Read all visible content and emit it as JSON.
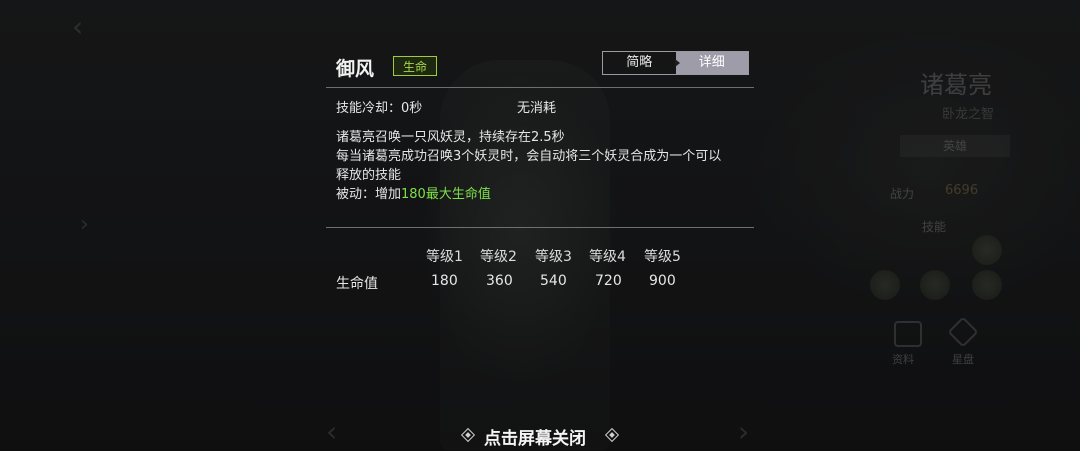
{
  "skill": {
    "name": "御风",
    "badge": "生命",
    "tabs": [
      "简略",
      "详细"
    ],
    "active_tab": "详细",
    "cooldown": "技能冷却：0秒",
    "cost": "无消耗",
    "desc_lines": [
      "诸葛亮召唤一只风妖灵，持续存在2.5秒",
      "每当诸葛亮成功召唤3个妖灵时，会自动将三个妖灵合成为一个可以",
      "释放的技能"
    ],
    "passive_prefix": "被动：增加",
    "passive_highlight": "180最大生命值",
    "levels": [
      "等级1",
      "等级2",
      "等级3",
      "等级4",
      "等级5"
    ],
    "stat_label": "生命值",
    "stat_values": [
      "180",
      "360",
      "540",
      "720",
      "900"
    ],
    "accent_color": "#7ee04a",
    "badge_color": "#9ccc3c"
  },
  "close_hint": "点击屏幕关闭",
  "hero_panel": {
    "name": "诸葛亮",
    "title": "卧龙之智",
    "tab": "英雄",
    "power_label": "战力",
    "power_value": "6696",
    "skill_label": "技能",
    "link_1": "资料",
    "link_2": "星盘"
  }
}
